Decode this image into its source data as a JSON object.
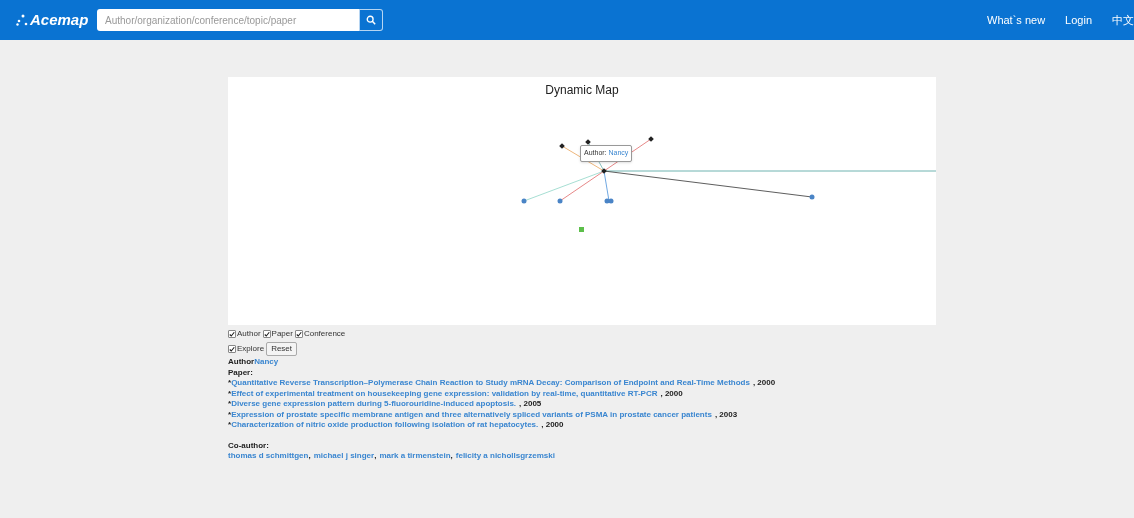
{
  "header": {
    "logo": "Acemap",
    "search": {
      "placeholder": "Author/organization/conference/topic/paper"
    },
    "nav": [
      "What`s new",
      "Login",
      "中文"
    ]
  },
  "map": {
    "title": "Dynamic Map",
    "tooltip": {
      "label": "Author:",
      "value": "Nancy"
    }
  },
  "filters": [
    {
      "label": "Author",
      "checked": true
    },
    {
      "label": "Paper",
      "checked": true
    },
    {
      "label": "Conference",
      "checked": true
    }
  ],
  "explore": {
    "label": "Explore",
    "checked": true
  },
  "reset_button": "Reset",
  "author": {
    "label": "Author",
    "name": "Nancy"
  },
  "paper_label": "Paper:",
  "papers": [
    {
      "bullet": "*",
      "title": "Quantitative Reverse Transcription–Polymerase Chain Reaction to Study mRNA Decay: Comparison of Endpoint and Real-Time Methods",
      "year": ", 2000"
    },
    {
      "bullet": "*",
      "title": "Effect of experimental treatment on housekeeping gene expression: validation by real-time, quantitative RT-PCR",
      "year": ", 2000"
    },
    {
      "bullet": "*",
      "title": "Diverse gene expression pattern during 5-fluorouridine-induced apoptosis.",
      "year": ", 2005"
    },
    {
      "bullet": "*",
      "title": "Expression of prostate specific membrane antigen and three alternatively spliced variants of PSMA in prostate cancer patients",
      "year": ", 2003"
    },
    {
      "bullet": "*",
      "title": "Characterization of nitric oxide production following isolation of rat hepatocytes.",
      "year": ", 2000"
    }
  ],
  "coauthor_label": "Co-author:",
  "coauthors": [
    {
      "name": "thomas d schmittgen",
      "separator": ","
    },
    {
      "name": "michael j singer",
      "separator": ","
    },
    {
      "name": "mark a tirmenstein",
      "separator": ","
    },
    {
      "name": "felicity a nichollsgrzemski"
    }
  ]
}
